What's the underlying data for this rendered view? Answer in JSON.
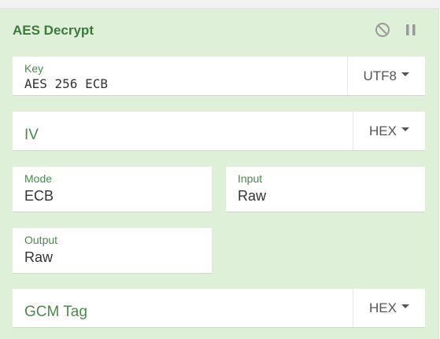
{
  "operation": {
    "title": "AES Decrypt",
    "controls": {
      "disable_icon": "disable-icon",
      "pause_icon": "pause-icon"
    }
  },
  "fields": {
    "key": {
      "label": "Key",
      "value": "AES 256 ECB",
      "format": "UTF8"
    },
    "iv": {
      "placeholder": "IV",
      "format": "HEX"
    },
    "mode": {
      "label": "Mode",
      "value": "ECB"
    },
    "input": {
      "label": "Input",
      "value": "Raw"
    },
    "output": {
      "label": "Output",
      "value": "Raw"
    },
    "gcm_tag": {
      "placeholder": "GCM Tag",
      "format": "HEX"
    }
  },
  "colors": {
    "panel_bg": "#dff0d8",
    "accent": "#3c7a3c"
  }
}
